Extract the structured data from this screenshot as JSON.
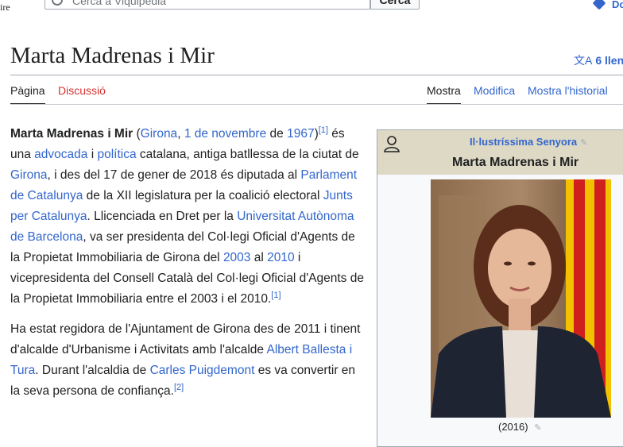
{
  "header": {
    "wordmark": "ire",
    "search_placeholder": "Cerca a Viquipèdia",
    "search_button": "Cerca",
    "account_text": "Do"
  },
  "page": {
    "title": "Marta Madrenas i Mir",
    "languages": "6 llen"
  },
  "tabs": {
    "left": [
      "Pàgina",
      "Discussió"
    ],
    "right": [
      "Mostra",
      "Modifica",
      "Mostra l'historial"
    ]
  },
  "paragraph1": [
    {
      "t": "Marta Madrenas i Mir",
      "s": "b"
    },
    {
      "t": " (",
      "s": ""
    },
    {
      "t": "Girona",
      "s": "link"
    },
    {
      "t": ", ",
      "s": ""
    },
    {
      "t": "1 de novembre",
      "s": "link"
    },
    {
      "t": " de ",
      "s": ""
    },
    {
      "t": "1967",
      "s": "link"
    },
    {
      "t": ")",
      "s": ""
    },
    {
      "t": "[1]",
      "s": "sup"
    },
    {
      "t": " és una ",
      "s": ""
    },
    {
      "t": "advocada",
      "s": "link"
    },
    {
      "t": " i ",
      "s": ""
    },
    {
      "t": "política",
      "s": "link"
    },
    {
      "t": " catalana, antiga batllessa de la ciutat de ",
      "s": ""
    },
    {
      "t": "Girona",
      "s": "link"
    },
    {
      "t": ", i des del 17 de gener de 2018 és diputada al ",
      "s": ""
    },
    {
      "t": "Parlament de Catalunya",
      "s": "link"
    },
    {
      "t": " de la XII legislatura per la coalició electoral ",
      "s": ""
    },
    {
      "t": "Junts per Catalunya",
      "s": "link"
    },
    {
      "t": ". Llicenciada en Dret per la ",
      "s": ""
    },
    {
      "t": "Universitat Autònoma de Barcelona",
      "s": "link"
    },
    {
      "t": ", va ser presidenta del Col·legi Oficial d'Agents de la Propietat Immobiliaria de Girona del ",
      "s": ""
    },
    {
      "t": "2003",
      "s": "link"
    },
    {
      "t": " al ",
      "s": ""
    },
    {
      "t": "2010",
      "s": "link"
    },
    {
      "t": " i vicepresidenta del Consell Català del Col·legi Oficial d'Agents de la Propietat Immobiliaria entre el 2003 i el 2010.",
      "s": ""
    },
    {
      "t": "[1]",
      "s": "sup"
    }
  ],
  "paragraph2": [
    {
      "t": "Ha estat regidora de l'Ajuntament de Girona des de 2011 i tinent d'alcalde d'Urbanisme i Activitats amb l'alcalde ",
      "s": ""
    },
    {
      "t": "Albert Ballesta i Tura",
      "s": "link"
    },
    {
      "t": ". Durant l'alcaldia de ",
      "s": ""
    },
    {
      "t": "Carles Puigdemont",
      "s": "link"
    },
    {
      "t": " es va convertir en la seva persona de confiança.",
      "s": ""
    },
    {
      "t": "[2]",
      "s": "sup"
    }
  ],
  "infobox": {
    "role": "Il·lustríssima Senyora",
    "name": "Marta Madrenas i Mir",
    "caption": "(2016)"
  }
}
